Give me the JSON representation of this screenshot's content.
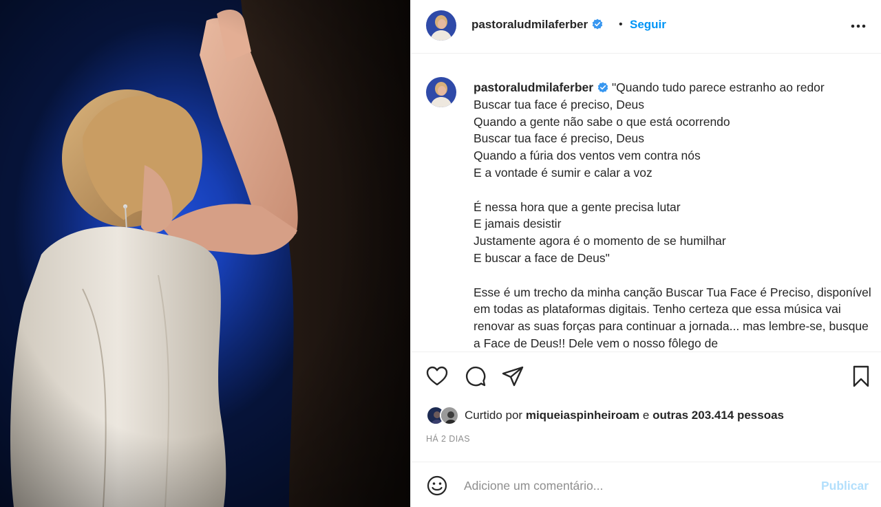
{
  "post": {
    "image_alt": "woman praying against a wall",
    "colors": {
      "background_blue": "#1f4fd6",
      "dress": "#e6e1d8"
    }
  },
  "header": {
    "username": "pastoraludmilaferber",
    "verified": true,
    "separator": "•",
    "follow_label": "Seguir",
    "more_icon": "more-horizontal-icon"
  },
  "caption": {
    "username": "pastoraludmilaferber",
    "lines": [
      "\"Quando tudo parece estranho ao redor",
      "Buscar tua face é preciso, Deus",
      "Quando a gente não sabe o que está ocorrendo",
      "Buscar tua face é preciso, Deus",
      "Quando a fúria dos ventos vem contra nós",
      "E a vontade é sumir e calar a voz",
      "É nessa hora que a gente precisa lutar",
      "E jamais desistir",
      "Justamente agora é o momento de se humilhar",
      "E buscar a face de Deus\""
    ],
    "paragraph": "Esse é um trecho da minha canção Buscar Tua Face é Preciso, disponível em todas as plataformas digitais. Tenho certeza que essa música vai renovar as suas forças para continuar a jornada... mas lembre-se, busque a Face de Deus!! Dele vem o nosso fôlego de"
  },
  "actions": {
    "like_icon": "heart-icon",
    "comment_icon": "comment-icon",
    "share_icon": "share-icon",
    "save_icon": "bookmark-icon"
  },
  "likes": {
    "prefix": "Curtido por",
    "user": "miqueiaspinheiroam",
    "connector": "e",
    "others": "outras 203.414 pessoas"
  },
  "timestamp": "HÁ 2 DIAS",
  "comment": {
    "placeholder": "Adicione um comentário...",
    "publish_label": "Publicar",
    "emoji_icon": "emoji-icon"
  },
  "accent_color": "#0095f6",
  "verified_color": "#3897f0"
}
